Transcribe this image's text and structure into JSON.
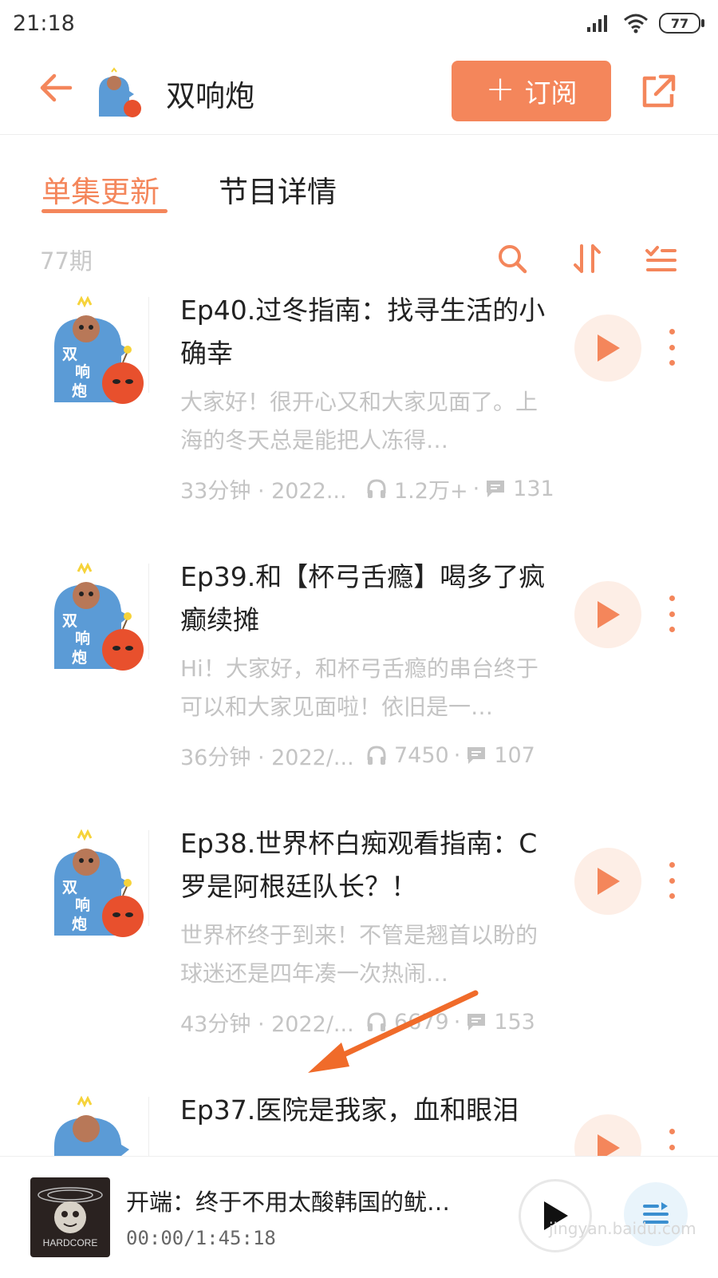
{
  "status_bar": {
    "time": "21:18",
    "battery": "77"
  },
  "header": {
    "title": "双响炮",
    "subscribe_label": "订阅"
  },
  "tabs": [
    {
      "label": "单集更新"
    },
    {
      "label": "节目详情"
    }
  ],
  "episode_count": "77期",
  "episodes": [
    {
      "title": "Ep40.过冬指南：找寻生活的小确幸",
      "description": "大家好！很开心又和大家见面了。上海的冬天总是能把人冻得…",
      "duration_date": "33分钟 · 2022...",
      "plays": "1.2万+",
      "comments": "131"
    },
    {
      "title": "Ep39.和【杯弓舌瘾】喝多了疯癫续摊",
      "description": "Hi！大家好，和杯弓舌瘾的串台终于可以和大家见面啦！依旧是一…",
      "duration_date": "36分钟 · 2022/...",
      "plays": "7450",
      "comments": "107"
    },
    {
      "title": "Ep38.世界杯白痴观看指南：C罗是阿根廷队长？！",
      "description": "世界杯终于到来！不管是翘首以盼的球迷还是四年凑一次热闹…",
      "duration_date": "43分钟 · 2022/...",
      "plays": "6679",
      "comments": "153"
    },
    {
      "title": "Ep37.医院是我家，血和眼泪",
      "description": "",
      "duration_date": "",
      "plays": "",
      "comments": ""
    }
  ],
  "player": {
    "title": "开端：终于不用太酸韩国的鱿…",
    "time": "00:00/1:45:18",
    "cover_text": "HARDCORE"
  },
  "watermark": "jingyan.baidu.com",
  "colors": {
    "accent": "#f4865b",
    "text": "#222222",
    "muted": "#c4c4c4"
  }
}
